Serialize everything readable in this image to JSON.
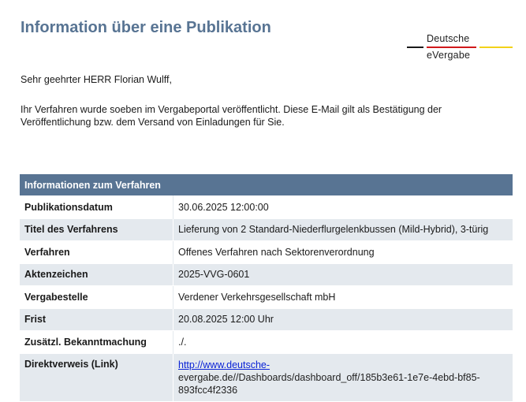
{
  "header": {
    "title": "Information über eine Publikation",
    "logo_line1": "Deutsche",
    "logo_line2": "eVergabe",
    "logo_colors": [
      "#1a1a1a",
      "#d0191b",
      "#f2d21a"
    ]
  },
  "greeting": "Sehr geehrter HERR Florian Wulff,",
  "message": "Ihr Verfahren wurde soeben im Vergabeportal veröffentlicht. Diese E-Mail gilt als Bestätigung der Veröffentlichung bzw. dem Versand von Einladungen für Sie.",
  "table": {
    "heading": "Informationen zum Verfahren",
    "rows": [
      {
        "label": "Publikationsdatum",
        "value": "30.06.2025 12:00:00"
      },
      {
        "label": "Titel des Verfahrens",
        "value": "Lieferung von 2 Standard-Niederflurgelenkbussen (Mild-Hybrid), 3-türig"
      },
      {
        "label": "Verfahren",
        "value": "Offenes Verfahren nach Sektorenverordnung"
      },
      {
        "label": "Aktenzeichen",
        "value": "2025-VVG-0601"
      },
      {
        "label": "Vergabestelle",
        "value": "Verdener Verkehrsgesellschaft mbH"
      },
      {
        "label": "Frist",
        "value": "20.08.2025 12:00 Uhr"
      },
      {
        "label": "Zusätzl. Bekanntmachung",
        "value": "./."
      },
      {
        "label": "Direktverweis (Link)",
        "link_part": "http://www.deutsche-",
        "rest_part": "evergabe.de//Dashboards/dashboard_off/185b3e61-1e7e-4ebd-bf85-893fcc4f2336"
      }
    ]
  },
  "colors": {
    "title": "#587493",
    "table_header": "#587493",
    "row_alt": "#e4e9ee",
    "link": "#0a23d6"
  }
}
